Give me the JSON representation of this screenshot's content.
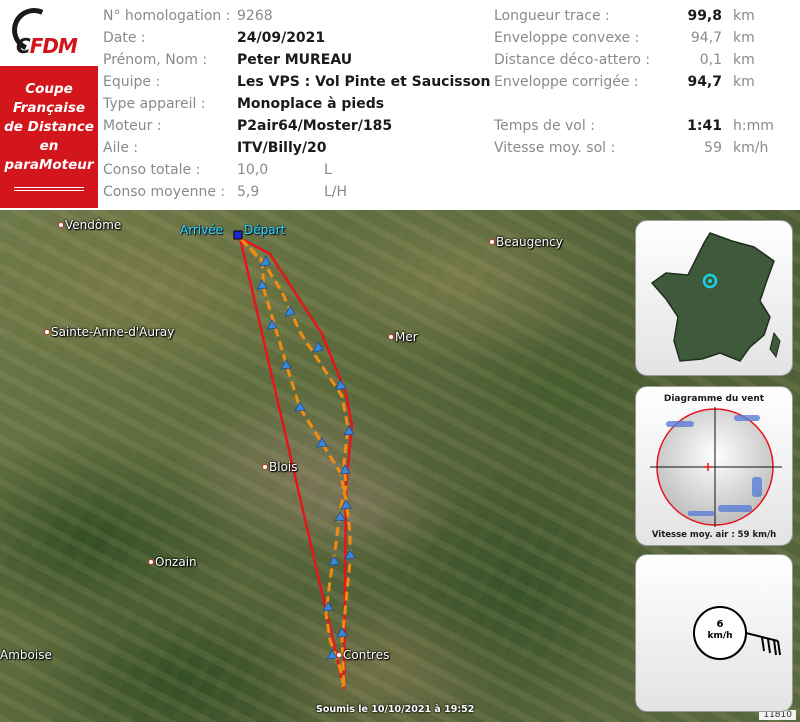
{
  "logo": {
    "prefix": "C",
    "fdm": "FDM"
  },
  "sidebar_title": "Coupe\nFrançaise\nde Distance\nen\nparaMoteur",
  "left_fields": [
    {
      "label": "N° homologation :",
      "value": "9268"
    },
    {
      "label": "Date :",
      "value": "24/09/2021"
    },
    {
      "label": "Prénom, Nom :",
      "value": "Peter MUREAU"
    },
    {
      "label": "Equipe :",
      "value": "Les VPS : Vol Pinte et Saucisson"
    },
    {
      "label": "Type appareil :",
      "value": "Monoplace à pieds"
    },
    {
      "label": "Moteur :",
      "value": "P2air64/Moster/185"
    },
    {
      "label": "Aile :",
      "value": "ITV/Billy/20"
    },
    {
      "label": "Conso totale :",
      "value": "10,0",
      "unit": "L"
    },
    {
      "label": "Conso moyenne :",
      "value": "5,9",
      "unit": "L/H"
    }
  ],
  "right_fields": [
    {
      "label": "Longueur trace :",
      "value": "99,8",
      "unit": "km"
    },
    {
      "label": "Enveloppe convexe :",
      "value": "94,7",
      "unit": "km"
    },
    {
      "label": "Distance déco-attero :",
      "value": "0,1",
      "unit": "km"
    },
    {
      "label": "Enveloppe corrigée :",
      "value": "94,7",
      "unit": "km"
    },
    {
      "label": "Temps de vol :",
      "value": "1:41",
      "unit": "h:mm"
    },
    {
      "label": "Vitesse moy. sol :",
      "value": "59",
      "unit": "km/h"
    }
  ],
  "map": {
    "towns": [
      "Vendôme",
      "Beaugency",
      "Sainte-Anne-d'Auray",
      "Mer",
      "Blois",
      "Onzain",
      "Contres",
      "Amboise"
    ],
    "start_label": "Départ",
    "end_label": "Arrivée",
    "submitted": "Soumis le 10/10/2021 à 19:52",
    "id": "11810",
    "colors": {
      "track": "#f28c0f",
      "envelope": "#e8141c",
      "arrow": "#3d86d6",
      "label": "#2ee0ee"
    }
  },
  "wind_panel": {
    "title": "Diagramme du vent",
    "caption": "Vitesse moy. air : 59 km/h"
  },
  "wind_speed_panel": {
    "value": "6",
    "unit": "km/h"
  },
  "icons": {
    "france": "france-map-icon",
    "wind_barb": "wind-barb-icon"
  }
}
